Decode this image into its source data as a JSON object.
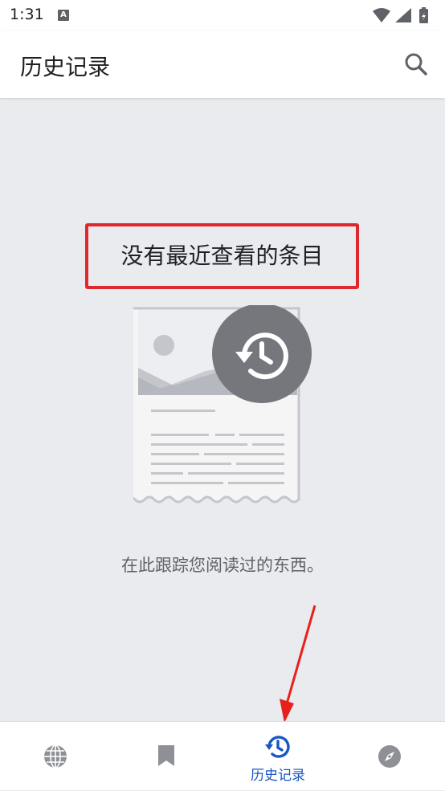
{
  "status_bar": {
    "time": "1:31",
    "notification_icon": "A"
  },
  "app_bar": {
    "title": "历史记录",
    "search_icon": "search-icon"
  },
  "empty_state": {
    "title": "没有最近查看的条目",
    "description": "在此跟踪您阅读过的东西。",
    "illustration_icon": "history-icon"
  },
  "bottom_nav": {
    "items": [
      {
        "id": "web",
        "icon": "globe-icon",
        "label": "",
        "active": false
      },
      {
        "id": "bookmarks",
        "icon": "bookmark-icon",
        "label": "",
        "active": false
      },
      {
        "id": "history",
        "icon": "history-icon",
        "label": "历史记录",
        "active": true
      },
      {
        "id": "explore",
        "icon": "compass-icon",
        "label": "",
        "active": false
      }
    ]
  },
  "colors": {
    "accent": "#1a56c4",
    "highlight_border": "#e0282c",
    "annotation_arrow": "#e8201c",
    "background": "#eaebee"
  }
}
